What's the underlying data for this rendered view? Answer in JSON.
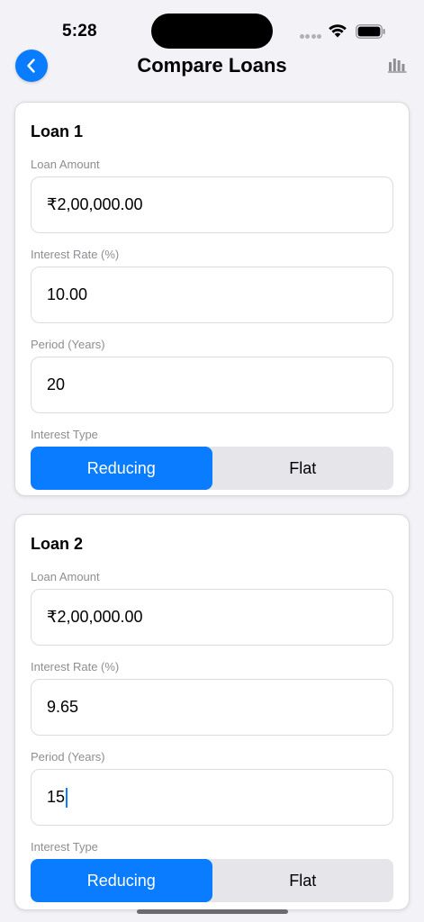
{
  "status": {
    "time": "5:28"
  },
  "nav": {
    "title": "Compare Loans"
  },
  "loans": [
    {
      "title": "Loan 1",
      "amount_label": "Loan Amount",
      "amount": "₹2,00,000.00",
      "rate_label": "Interest Rate (%)",
      "rate": "10.00",
      "period_label": "Period (Years)",
      "period": "20",
      "type_label": "Interest Type",
      "type_options": [
        "Reducing",
        "Flat"
      ],
      "type_selected": "Reducing"
    },
    {
      "title": "Loan 2",
      "amount_label": "Loan Amount",
      "amount": "₹2,00,000.00",
      "rate_label": "Interest Rate (%)",
      "rate": "9.65",
      "period_label": "Period (Years)",
      "period": "15",
      "type_label": "Interest Type",
      "type_options": [
        "Reducing",
        "Flat"
      ],
      "type_selected": "Reducing"
    }
  ],
  "icons": {
    "back": "chevron-left-icon",
    "chart": "bar-chart-icon",
    "wifi": "wifi-icon",
    "battery": "battery-icon"
  },
  "colors": {
    "accent": "#0a7cff",
    "background": "#f2f2f7",
    "segment_inactive": "#e5e5ea"
  }
}
